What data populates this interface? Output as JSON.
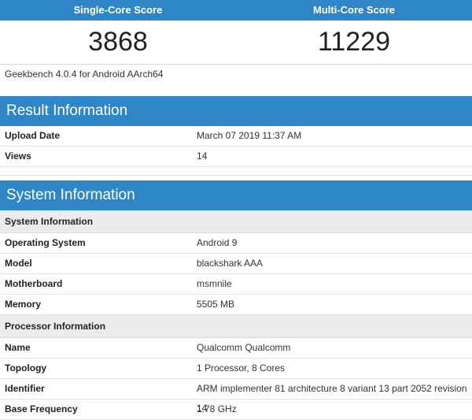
{
  "scores": {
    "single_label": "Single-Core Score",
    "multi_label": "Multi-Core Score",
    "single_value": "3868",
    "multi_value": "11229"
  },
  "version": "Geekbench 4.0.4 for Android AArch64",
  "result": {
    "title": "Result Information",
    "rows": [
      {
        "label": "Upload Date",
        "value": "March 07 2019 11:37 AM"
      },
      {
        "label": "Views",
        "value": "14"
      }
    ]
  },
  "system": {
    "title": "System Information",
    "sys_subhead": "System Information",
    "sys_rows": [
      {
        "label": "Operating System",
        "value": "Android 9"
      },
      {
        "label": "Model",
        "value": "blackshark AAA"
      },
      {
        "label": "Motherboard",
        "value": "msmnile"
      },
      {
        "label": "Memory",
        "value": "5505 MB"
      }
    ],
    "proc_subhead": "Processor Information",
    "proc_rows": [
      {
        "label": "Name",
        "value": "Qualcomm Qualcomm"
      },
      {
        "label": "Topology",
        "value": "1 Processor, 8 Cores"
      },
      {
        "label": "Identifier",
        "value": "ARM implementer 81 architecture 8 variant 13 part 2052 revision 14"
      },
      {
        "label": "Base Frequency",
        "value": "1.78 GHz"
      }
    ]
  },
  "colors": {
    "accent": "#2f86c6",
    "subhead_bg": "#ececec"
  }
}
